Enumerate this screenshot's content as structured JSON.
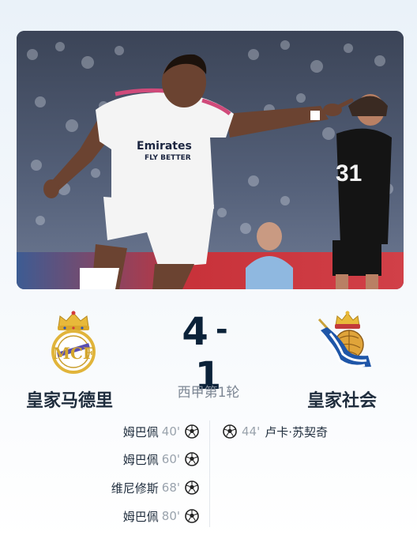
{
  "match": {
    "home_team": "皇家马德里",
    "away_team": "皇家社会",
    "home_score": "4",
    "separator": "-",
    "away_score": "1",
    "competition": "西甲第1轮"
  },
  "photo": {
    "jersey_text_line1": "Emirates",
    "jersey_text_line2": "FLY BETTER",
    "jersey_number": "31"
  },
  "events": {
    "home": [
      {
        "player": "姆巴佩",
        "minute": "40'",
        "icon": "soccer-ball-icon"
      },
      {
        "player": "姆巴佩",
        "minute": "60'",
        "icon": "soccer-ball-icon"
      },
      {
        "player": "维尼修斯",
        "minute": "68'",
        "icon": "soccer-ball-icon"
      },
      {
        "player": "姆巴佩",
        "minute": "80'",
        "icon": "soccer-ball-icon"
      }
    ],
    "away": [
      {
        "player": "卢卡·苏契奇",
        "minute": "44'",
        "icon": "soccer-ball-icon"
      }
    ]
  },
  "colors": {
    "score": "#0b2239",
    "team_name": "#1f2d3d",
    "minute": "#9aa3ad",
    "competition": "#7d8794"
  }
}
